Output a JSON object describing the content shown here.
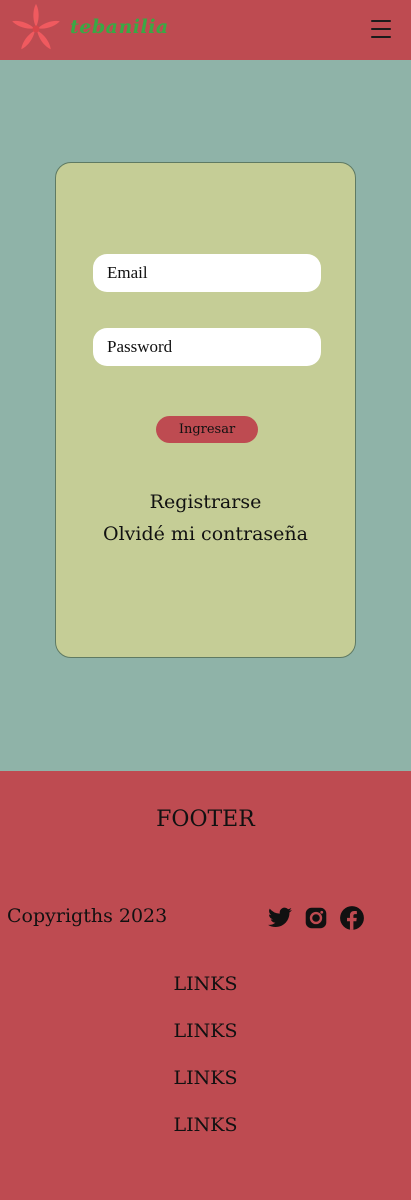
{
  "header": {
    "brand": "tebanilia",
    "logo_icon": "flower-logo-icon",
    "menu_icon": "hamburger-menu-icon"
  },
  "login": {
    "email_placeholder": "Email",
    "password_placeholder": "Password",
    "submit_label": "Ingresar",
    "register_label": "Registrarse",
    "forgot_label": "Olvidé mi contraseña"
  },
  "footer": {
    "title": "FOOTER",
    "copyright": "Copyrigths 2023",
    "social": [
      "twitter-icon",
      "instagram-icon",
      "facebook-icon"
    ],
    "links": [
      "LINKS",
      "LINKS",
      "LINKS",
      "LINKS"
    ]
  },
  "colors": {
    "header_bg": "#be4b51",
    "page_bg": "#8fb3a8",
    "card_bg": "#c5cd96",
    "brand_green": "#3aa845",
    "logo_pink": "#f05a5f"
  }
}
